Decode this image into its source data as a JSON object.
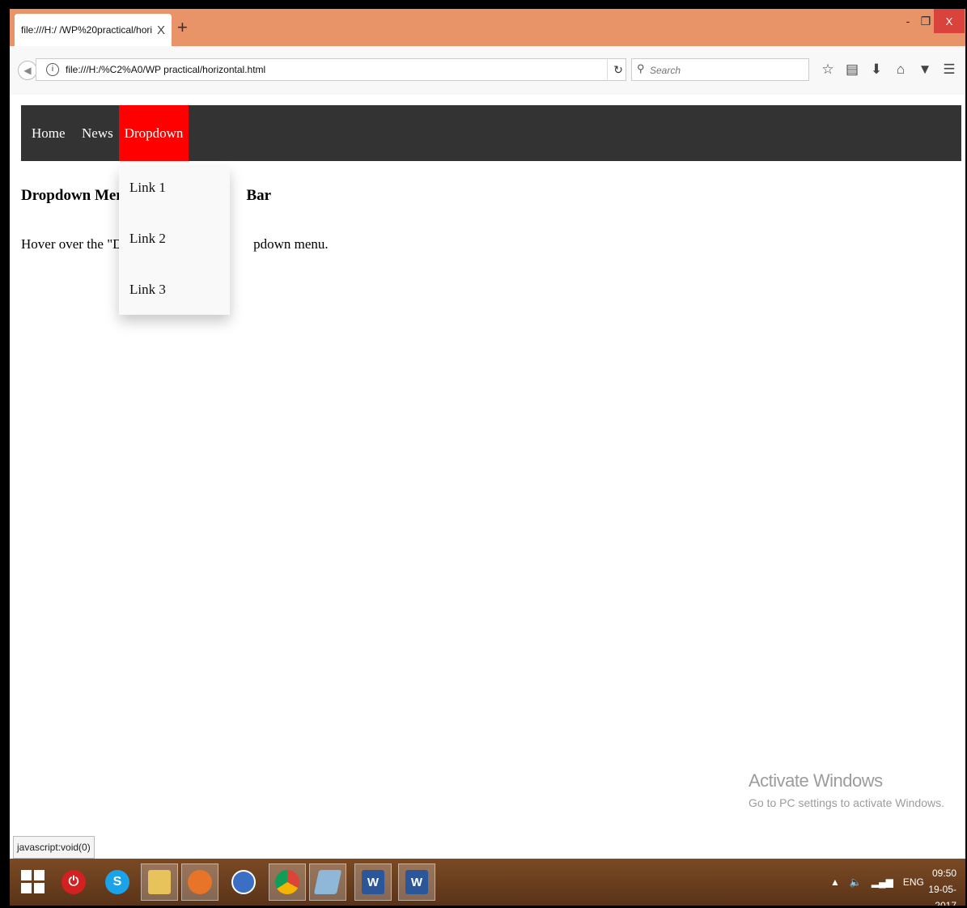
{
  "browser": {
    "tab_title": "file:///H:/ /WP%20practical/hori",
    "tab_close": "X",
    "new_tab": "+",
    "url": "file:///H:/%C2%A0/WP practical/horizontal.html",
    "search_placeholder": "Search",
    "window_controls": {
      "minimize": "-",
      "restore": "❐",
      "close": "X"
    }
  },
  "page": {
    "nav": {
      "home": "Home",
      "news": "News",
      "dropdown": "Dropdown",
      "dropdown_links": [
        "Link 1",
        "Link 2",
        "Link 3"
      ],
      "active_color": "#ff0000",
      "bar_color": "#333333"
    },
    "heading_left": "Dropdown Menu",
    "heading_right": "Bar",
    "para_left": "Hover over the \"Drop",
    "para_right": "pdown menu."
  },
  "watermark": {
    "title": "Activate Windows",
    "subtitle": "Go to PC settings to activate Windows."
  },
  "status_bar": "javascript:void(0)",
  "taskbar": {
    "tray_lang": "ENG",
    "time": "09:50",
    "date": "19-05-2017"
  }
}
